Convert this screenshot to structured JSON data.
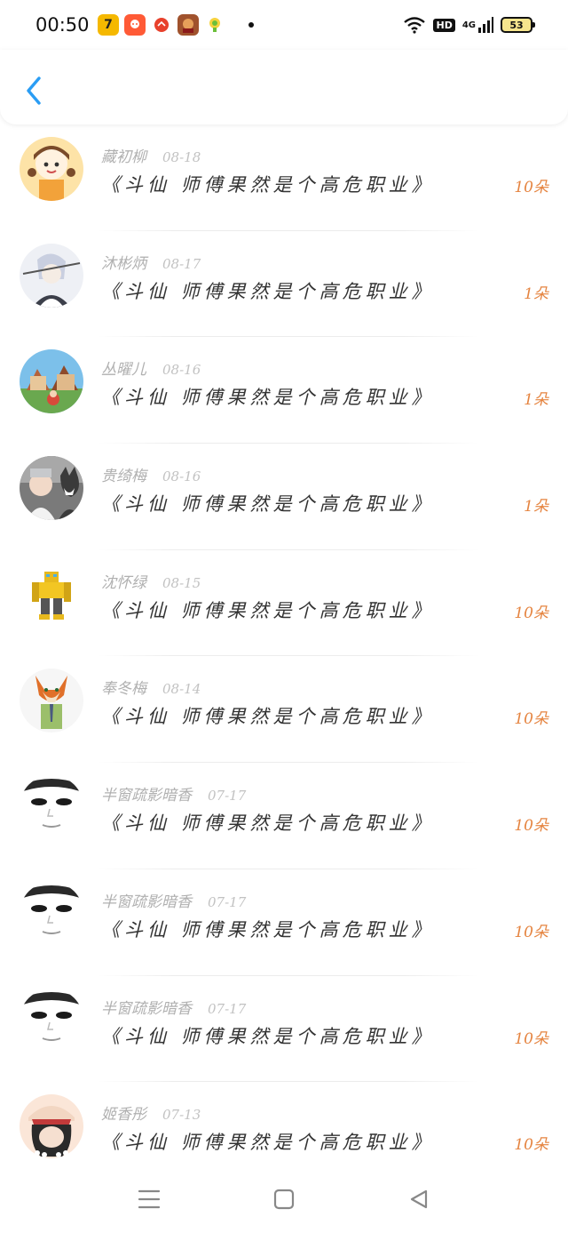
{
  "status_bar": {
    "time": "00:50",
    "icons": [
      "app-icon-7",
      "app-icon-ima",
      "app-icon-orange",
      "app-icon-game",
      "app-icon-green"
    ],
    "hd": "HD",
    "network": "4G",
    "battery": "53"
  },
  "header": {
    "back_icon": "chevron-left-icon",
    "accent": "#2a9df4"
  },
  "records": [
    {
      "name": "藏初柳",
      "date": "08-18",
      "message": "《斗仙 师傅果然是个高危职业》",
      "amount": "10朵",
      "avatar": "cartoon-girl"
    },
    {
      "name": "沐彬炳",
      "date": "08-17",
      "message": "《斗仙 师傅果然是个高危职业》",
      "amount": "1朵",
      "avatar": "anime-swordsman"
    },
    {
      "name": "丛曜儿",
      "date": "08-16",
      "message": "《斗仙 师傅果然是个高危职业》",
      "amount": "1朵",
      "avatar": "cartoon-village"
    },
    {
      "name": "贵绮梅",
      "date": "08-16",
      "message": "《斗仙 师傅果然是个高危职业》",
      "amount": "1朵",
      "avatar": "child-with-dog"
    },
    {
      "name": "沈怀绿",
      "date": "08-15",
      "message": "《斗仙 师傅果然是个高危职业》",
      "amount": "10朵",
      "avatar": "yellow-robot"
    },
    {
      "name": "奉冬梅",
      "date": "08-14",
      "message": "《斗仙 师傅果然是个高危职业》",
      "amount": "10朵",
      "avatar": "cartoon-fox"
    },
    {
      "name": "半窗疏影暗香",
      "date": "07-17",
      "message": "《斗仙 师傅果然是个高危职业》",
      "amount": "10朵",
      "avatar": "face-sketch"
    },
    {
      "name": "半窗疏影暗香",
      "date": "07-17",
      "message": "《斗仙 师傅果然是个高危职业》",
      "amount": "10朵",
      "avatar": "face-sketch"
    },
    {
      "name": "半窗疏影暗香",
      "date": "07-17",
      "message": "《斗仙 师傅果然是个高危职业》",
      "amount": "10朵",
      "avatar": "face-sketch"
    },
    {
      "name": "姬香彤",
      "date": "07-13",
      "message": "《斗仙 师傅果然是个高危职业》",
      "amount": "10朵",
      "avatar": "girl-with-cap"
    }
  ],
  "nav": {
    "menu_icon": "menu-icon",
    "home_icon": "home-square-icon",
    "back_icon": "back-triangle-icon"
  }
}
